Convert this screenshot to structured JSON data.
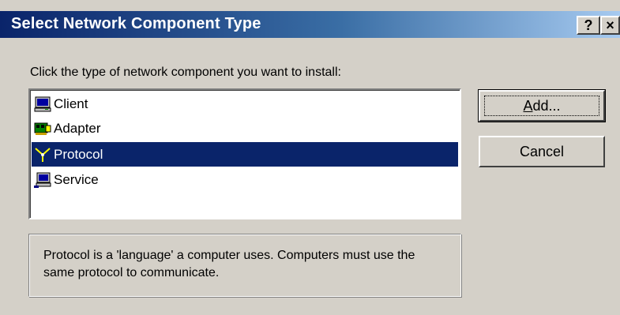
{
  "window": {
    "title": "Select Network Component Type",
    "help_glyph": "?",
    "close_glyph": "×"
  },
  "instruction": "Click the type of network component you want to install:",
  "component_list": {
    "items": [
      {
        "label": "Client",
        "icon": "computer-icon",
        "selected": false
      },
      {
        "label": "Adapter",
        "icon": "network-card-icon",
        "selected": false
      },
      {
        "label": "Protocol",
        "icon": "protocol-icon",
        "selected": true
      },
      {
        "label": "Service",
        "icon": "service-icon",
        "selected": false
      }
    ]
  },
  "buttons": {
    "add_prefix": "A",
    "add_rest": "dd...",
    "cancel_label": "Cancel"
  },
  "description": "Protocol is a 'language' a computer uses. Computers must use the same protocol to communicate.",
  "colors": {
    "title_bar_start": "#0a246a",
    "title_bar_end": "#a6caf0",
    "selection": "#0a246a",
    "face": "#d4d0c8"
  }
}
